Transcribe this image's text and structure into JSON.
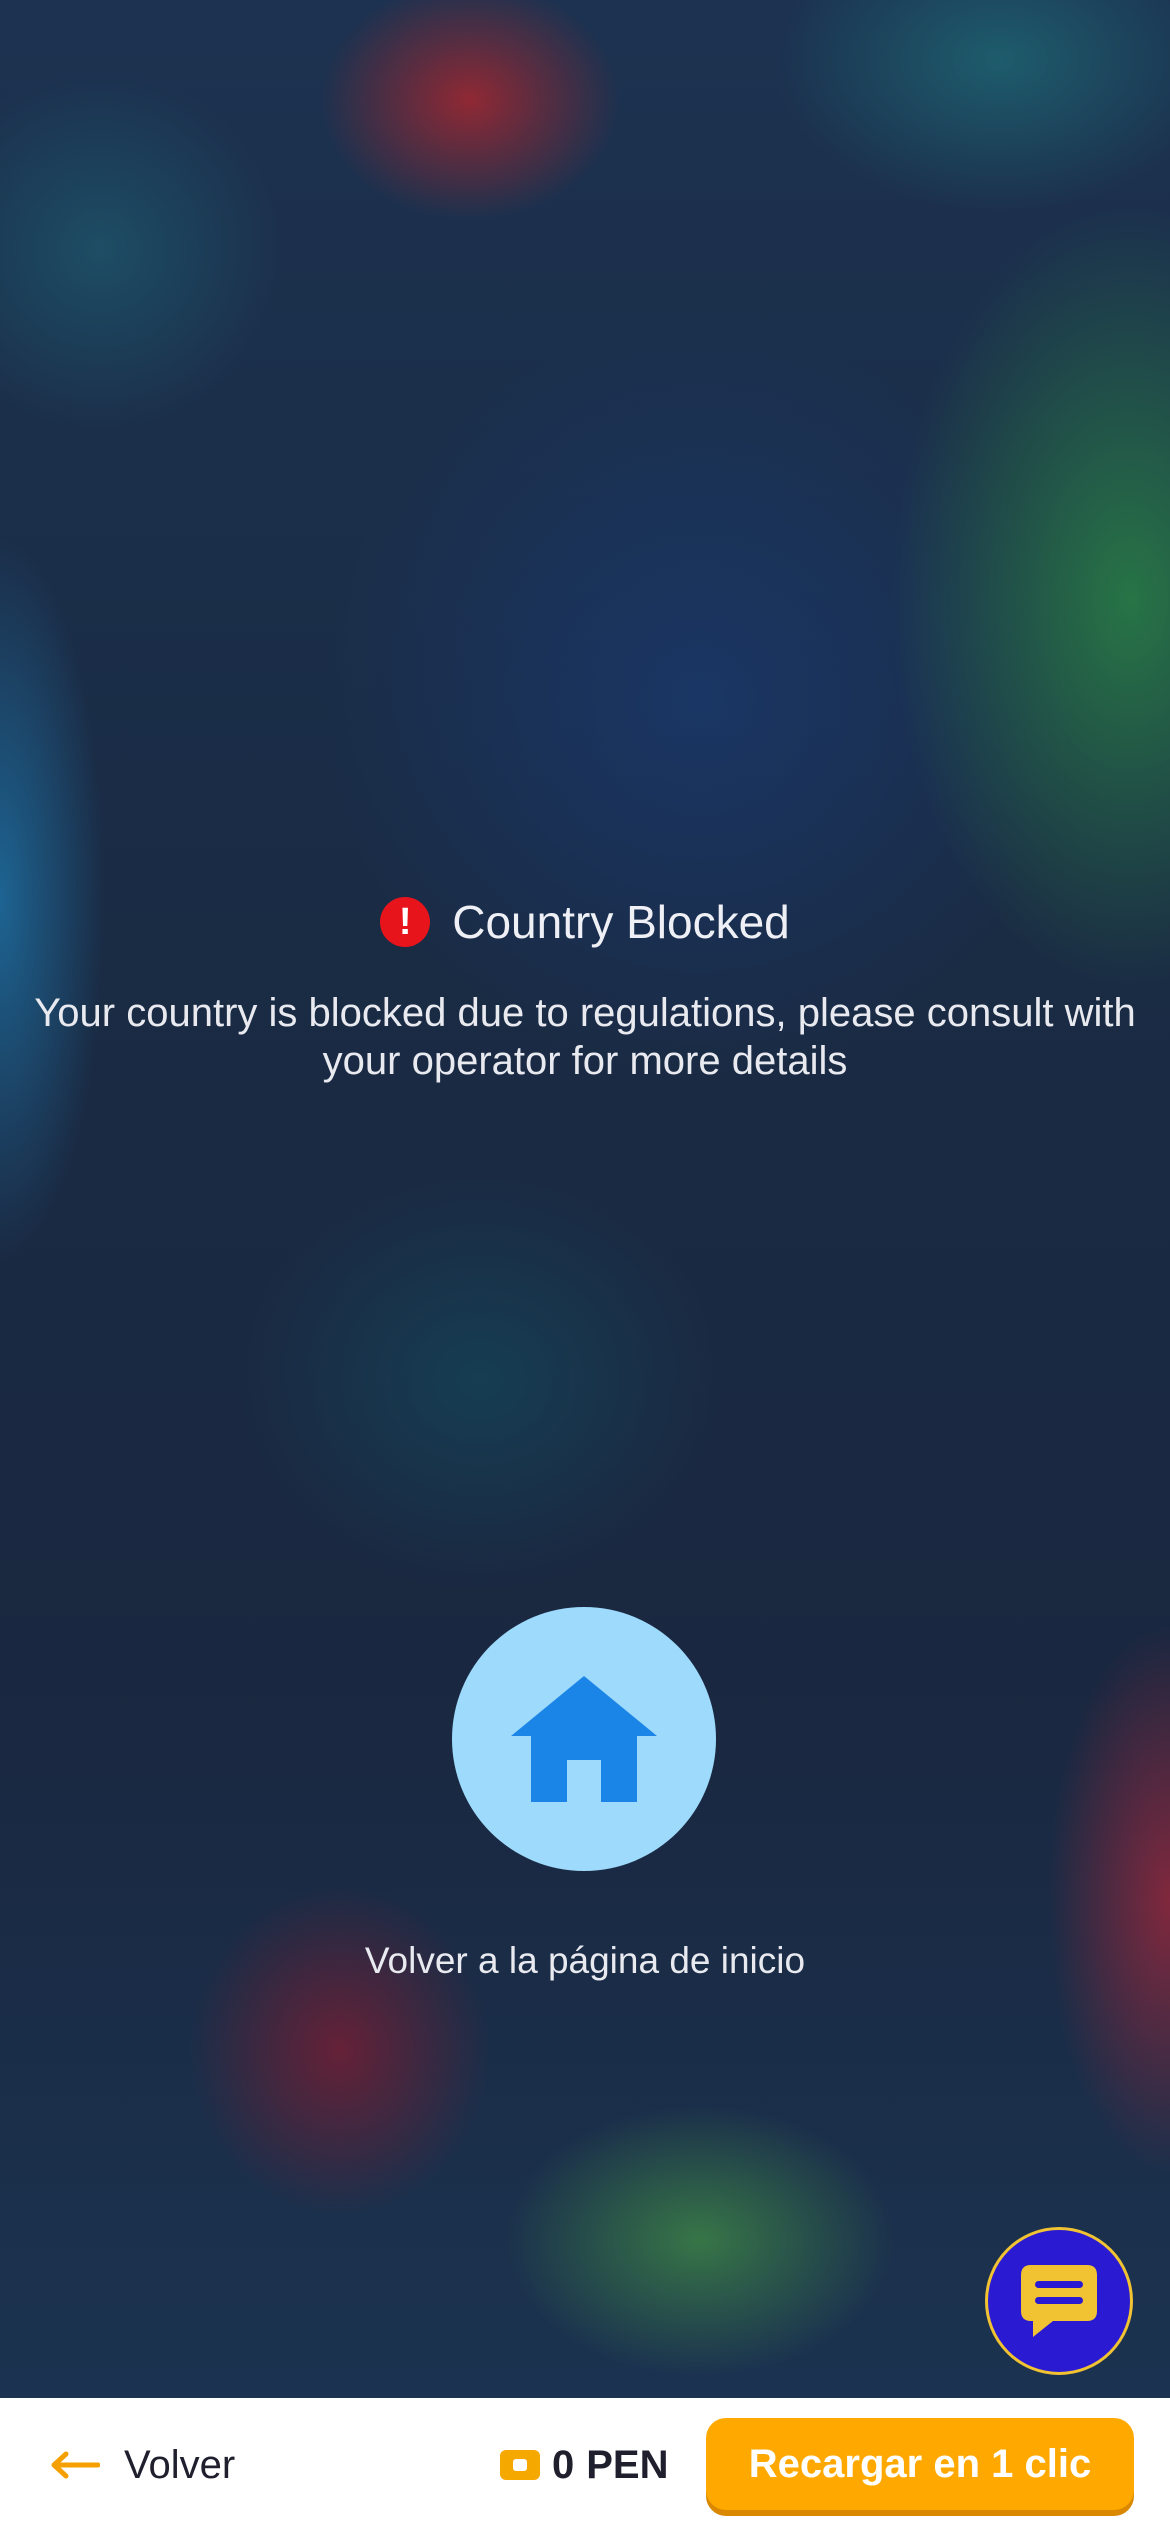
{
  "notice": {
    "icon": "alert-circle-icon",
    "title": "Country Blocked",
    "message": "Your country is blocked due to regulations, please consult with your operator for more details"
  },
  "home": {
    "icon": "home-icon",
    "label": "Volver a la página de inicio"
  },
  "chat": {
    "icon": "chat-bubble-icon"
  },
  "bottom_bar": {
    "back_label": "Volver",
    "back_icon": "arrow-left-icon",
    "balance_icon": "wallet-icon",
    "balance_amount": "0",
    "balance_currency": "PEN",
    "recharge_label": "Recargar en 1 clic"
  },
  "colors": {
    "accent": "#ffa800",
    "home_circle": "#9ddafc",
    "home_icon": "#1a85e6",
    "alert": "#e8141c",
    "chat_bg": "#2a1ad2",
    "chat_ring": "#f1c232"
  }
}
